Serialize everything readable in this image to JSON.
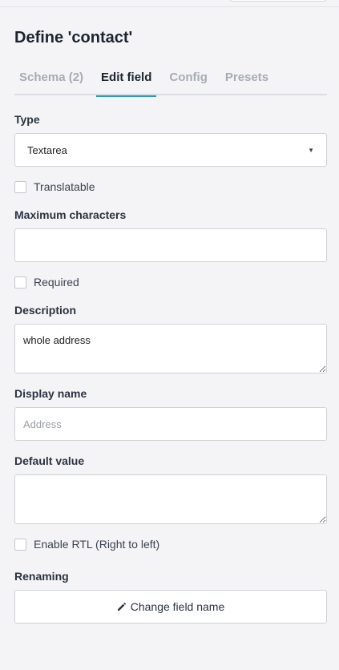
{
  "panel": {
    "title": "Define 'contact'"
  },
  "tabs": [
    {
      "label": "Schema (2)"
    },
    {
      "label": "Edit field"
    },
    {
      "label": "Config"
    },
    {
      "label": "Presets"
    }
  ],
  "form": {
    "type_label": "Type",
    "type_value": "Textarea",
    "translatable_label": "Translatable",
    "max_chars_label": "Maximum characters",
    "max_chars_value": "",
    "required_label": "Required",
    "description_label": "Description",
    "description_value": "whole address",
    "display_name_label": "Display name",
    "display_name_placeholder": "Address",
    "default_value_label": "Default value",
    "default_value_value": "",
    "rtl_label": "Enable RTL (Right to left)",
    "renaming_label": "Renaming",
    "change_name_button": "Change field name"
  },
  "icons": {
    "caret": "caret-down-icon",
    "pencil": "pencil-icon"
  },
  "colors": {
    "accent": "#2a9bb0",
    "tab_inactive": "#a7abb4",
    "text": "#1c2430"
  }
}
